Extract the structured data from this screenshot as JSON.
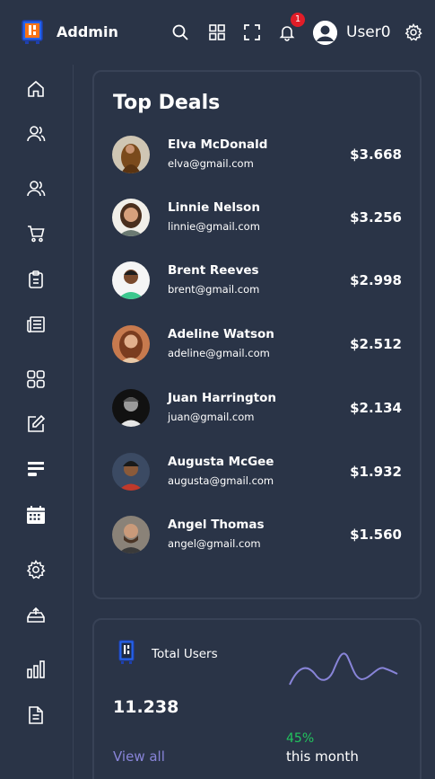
{
  "header": {
    "brand": "Addmin",
    "notification_count": "1",
    "username": "User0"
  },
  "top_deals": {
    "title": "Top Deals",
    "items": [
      {
        "name": "Elva McDonald",
        "email": "elva@gmail.com",
        "amount": "$3.668"
      },
      {
        "name": "Linnie Nelson",
        "email": "linnie@gmail.com",
        "amount": "$3.256"
      },
      {
        "name": "Brent Reeves",
        "email": "brent@gmail.com",
        "amount": "$2.998"
      },
      {
        "name": "Adeline Watson",
        "email": "adeline@gmail.com",
        "amount": "$2.512"
      },
      {
        "name": "Juan Harrington",
        "email": "juan@gmail.com",
        "amount": "$2.134"
      },
      {
        "name": "Augusta McGee",
        "email": "augusta@gmail.com",
        "amount": "$1.932"
      },
      {
        "name": "Angel Thomas",
        "email": "angel@gmail.com",
        "amount": "$1.560"
      }
    ]
  },
  "total_users": {
    "title": "Total Users",
    "value": "11.238",
    "link": "View all",
    "percent": "45%",
    "percent_label": "this month",
    "percent_color": "#22c55e",
    "line_color": "#8884d8"
  },
  "colors": {
    "background": "#2a3447",
    "border": "#384256",
    "accent": "#8884d8",
    "badge": "#e11d28"
  }
}
